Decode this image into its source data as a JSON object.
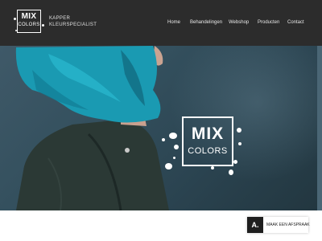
{
  "header": {
    "logo": {
      "line1": "MIX",
      "line2": "COLORS"
    },
    "tagline": {
      "line1": "KAPPER",
      "line2": "KLEURSPECIALIST"
    },
    "nav": [
      {
        "label": "Home"
      },
      {
        "label": "Behandelingen"
      },
      {
        "label": "Webshop"
      },
      {
        "label": "Producten"
      },
      {
        "label": "Contact"
      }
    ]
  },
  "hero": {
    "logo": {
      "line1": "MIX",
      "line2": "COLORS"
    }
  },
  "cta": {
    "badge": "A.",
    "label": "MAAK EEN AFSPRAAK"
  },
  "colors": {
    "header_bg": "#2c2c2c",
    "hero_bg": "#34505e",
    "hair": "#1a9ab2",
    "jacket": "#2b3935",
    "cta_badge": "#1e1e1e"
  }
}
